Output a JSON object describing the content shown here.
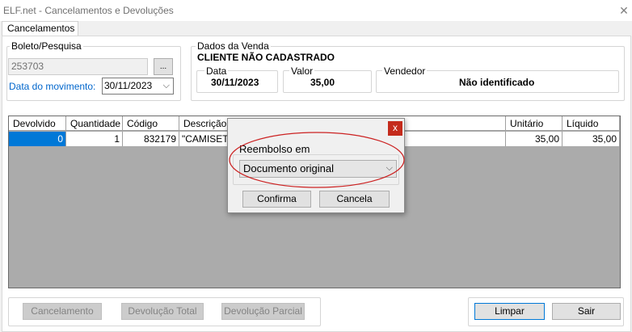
{
  "window": {
    "title": "ELF.net - Cancelamentos e Devoluções",
    "close_glyph": "✕"
  },
  "tabs": [
    {
      "label": "Cancelamentos"
    }
  ],
  "boleto": {
    "caption": "Boleto/Pesquisa",
    "value": "253703",
    "browse_label": "...",
    "date_label": "Data do movimento:",
    "date_value": "30/11/2023"
  },
  "venda": {
    "caption": "Dados da Venda",
    "cliente": "CLIENTE NÃO CADASTRADO",
    "data_label": "Data",
    "data_value": "30/11/2023",
    "valor_label": "Valor",
    "valor_value": "35,00",
    "vendedor_label": "Vendedor",
    "vendedor_value": "Não identificado"
  },
  "grid": {
    "columns": [
      "Devolvido",
      "Quantidade",
      "Código",
      "Descrição",
      "Unitário",
      "Líquido"
    ],
    "rows": [
      {
        "devolvido": "0",
        "quantidade": "1",
        "codigo": "832179",
        "descricao": "\"CAMISETA",
        "unitario": "35,00",
        "liquido": "35,00"
      }
    ]
  },
  "bottom_buttons": {
    "cancelamento": "Cancelamento",
    "devolucao_total": "Devolução Total",
    "devolucao_parcial": "Devolução Parcial",
    "limpar": "Limpar",
    "sair": "Sair"
  },
  "dialog": {
    "close_glyph": "x",
    "group_label": "Reembolso em",
    "selected_option": "Documento original",
    "confirm_label": "Confirma",
    "cancel_label": "Cancela"
  },
  "colors": {
    "selected_cell": "#0078d7",
    "link_label": "#0066cc",
    "annotation_ellipse": "#cc2222",
    "close_button": "#c42b1c"
  }
}
